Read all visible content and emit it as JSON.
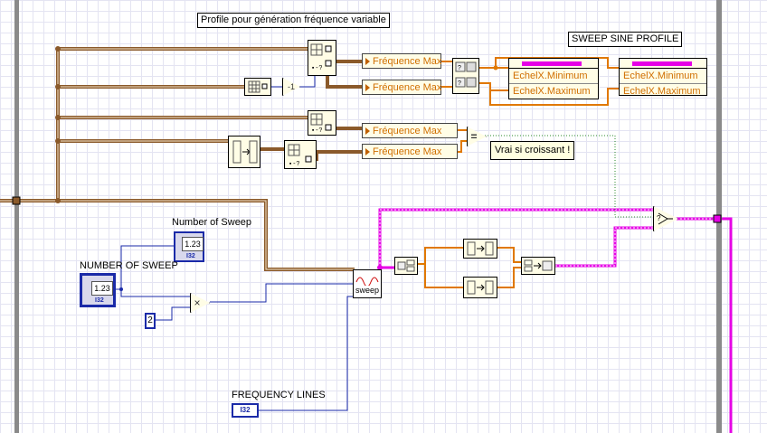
{
  "title_label": "Profile pour génération fréquence variable",
  "sweep_profile_label": "SWEEP SINE PROFILE",
  "properties": {
    "freq_max_1": "Fréquence Max",
    "freq_max_2": "Fréquence Max",
    "freq_max_3": "Fréquence Max",
    "freq_max_4": "Fréquence Max",
    "echelx_min_1": "EchelX.Minimum",
    "echelx_max_1": "EchelX.Maximum",
    "echelx_min_2": "EchelX.Minimum",
    "echelx_max_2": "EchelX.Maximum"
  },
  "comment_croissant": "Vrai si croissant !",
  "number_of_sweep_indicator": {
    "label": "Number of Sweep",
    "value": "1.23",
    "type": "I32"
  },
  "number_of_sweep_control": {
    "label": "NUMBER OF SWEEP",
    "value": "1.23",
    "type": "I32"
  },
  "constant_two": "2",
  "multiply_symbol": "×",
  "frequency_lines": {
    "label": "FREQUENCY LINES",
    "type": "I32"
  },
  "sweep_node_label": "sweep",
  "negate_symbol": "-1",
  "equal_symbol": "=",
  "colors": {
    "orange_wire": "#e07800",
    "pink_wire": "#e600e6",
    "blue_wire": "#1a2aa8",
    "brown_wire": "#8b5a2b",
    "green_dotted": "#2a8a2a"
  }
}
